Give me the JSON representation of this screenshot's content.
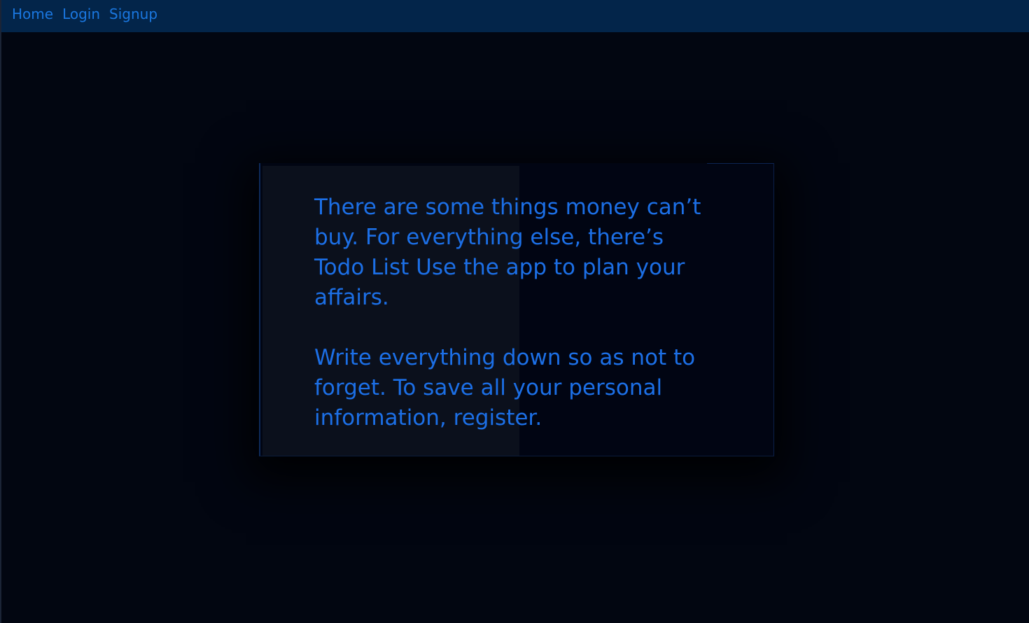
{
  "nav": {
    "links": [
      {
        "label": "Home"
      },
      {
        "label": "Login"
      },
      {
        "label": "Signup"
      }
    ]
  },
  "hero": {
    "paragraph1": "There are some things money can’t buy. For everything else, there’s Todo List Use the app to plan your affairs.",
    "paragraph2": "Write everything down so as not to forget. To save all your personal information, register."
  },
  "colors": {
    "background": "#020611",
    "navbar": "#03254a",
    "link": "#1a77e0",
    "text": "#1c6fe6",
    "panel": "#0b101c"
  }
}
